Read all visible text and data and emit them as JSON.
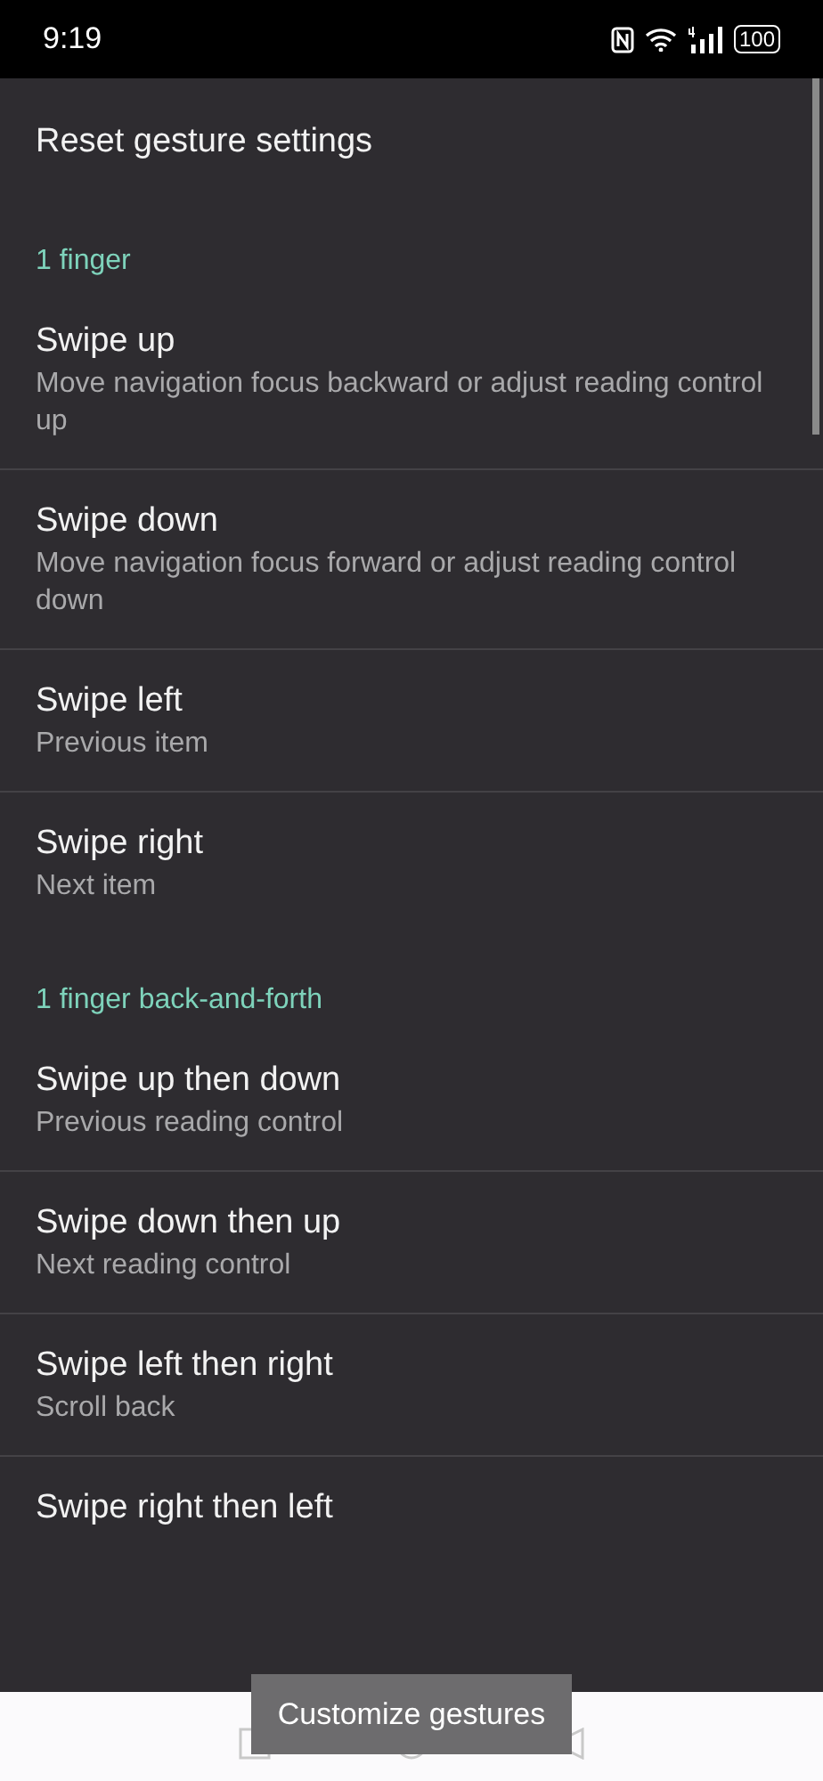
{
  "status_bar": {
    "time": "9:19",
    "battery": "100"
  },
  "reset": {
    "label": "Reset gesture settings"
  },
  "sections": [
    {
      "title": "1 finger",
      "items": [
        {
          "title": "Swipe up",
          "subtitle": "Move navigation focus backward or adjust reading control up"
        },
        {
          "title": "Swipe down",
          "subtitle": "Move navigation focus forward or adjust reading control down"
        },
        {
          "title": "Swipe left",
          "subtitle": "Previous item"
        },
        {
          "title": "Swipe right",
          "subtitle": "Next item"
        }
      ]
    },
    {
      "title": "1 finger back-and-forth",
      "items": [
        {
          "title": "Swipe up then down",
          "subtitle": "Previous reading control"
        },
        {
          "title": "Swipe down then up",
          "subtitle": "Next reading control"
        },
        {
          "title": "Swipe left then right",
          "subtitle": "Scroll back"
        },
        {
          "title": "Swipe right then left"
        }
      ]
    }
  ],
  "toast": "Customize gestures"
}
